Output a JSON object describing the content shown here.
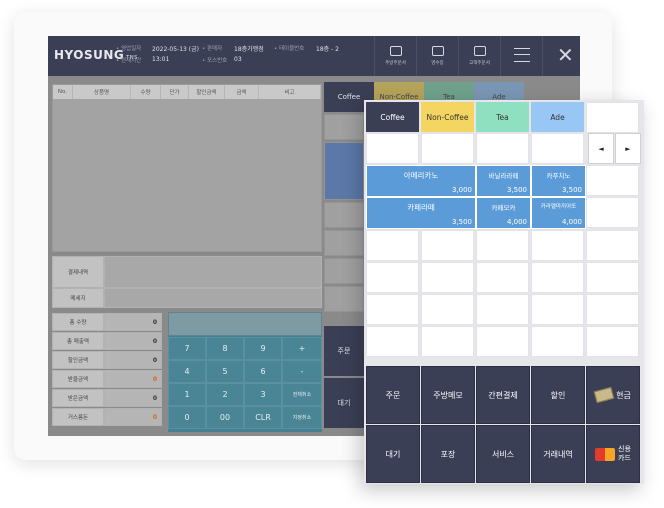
{
  "brand": {
    "name": "HYOSUNG",
    "suffix": "TNS"
  },
  "header_info": {
    "business_date_label": "• 영업일자",
    "business_date_value": "2022-05-13 (금)",
    "current_time_label": "• 현재시간",
    "current_time_value": "13:01",
    "clerk_label": "• 판매자",
    "clerk_value": "18층가맹점",
    "pos_label": "• 포스번호",
    "pos_value": "03",
    "table_label": "• 테이블번호",
    "table_value": "18층 - 2"
  },
  "header_buttons": [
    "주방주문서",
    "영수증",
    "고객주문서"
  ],
  "order_table": {
    "columns": [
      "No.",
      "상품명",
      "수량",
      "단가",
      "할인금액",
      "금액",
      "비고"
    ]
  },
  "info_labels": {
    "payment": "결제내역",
    "message": "메세지"
  },
  "summary": [
    {
      "label": "총 수량",
      "value": "0"
    },
    {
      "label": "총 매출액",
      "value": "0"
    },
    {
      "label": "할인금액",
      "value": "0"
    },
    {
      "label": "받을금액",
      "value": "0"
    },
    {
      "label": "받은금액",
      "value": "0"
    },
    {
      "label": "거스름돈",
      "value": "0"
    }
  ],
  "keypad": {
    "row1": [
      "7",
      "8",
      "9",
      "+"
    ],
    "row2": [
      "4",
      "5",
      "6",
      "-"
    ],
    "row3": [
      "1",
      "2",
      "3",
      "전체취소"
    ],
    "row4": [
      "0",
      "00",
      "CLR",
      "지정취소"
    ]
  },
  "back_actions": {
    "order": "주문",
    "hold": "대기"
  },
  "category_tabs": [
    {
      "label": "Coffee",
      "color": "#3b3f55",
      "text": "#ffffff"
    },
    {
      "label": "Non-Coffee",
      "color": "#f5d561",
      "text": "#333333"
    },
    {
      "label": "Tea",
      "color": "#8ee0c0",
      "text": "#333333"
    },
    {
      "label": "Ade",
      "color": "#98c6f5",
      "text": "#333333"
    }
  ],
  "pager": {
    "prev": "◄",
    "next": "►"
  },
  "products": [
    {
      "name": "아메리카노",
      "price": "3,000"
    },
    {
      "name": "바닐라라떼",
      "price": "3,500"
    },
    {
      "name": "카푸치노",
      "price": "3,500"
    },
    {
      "name": "카페라떼",
      "price": "3,500"
    },
    {
      "name": "카페모카",
      "price": "4,000"
    },
    {
      "name": "카라멜마끼아또",
      "price": "4,000"
    }
  ],
  "function_buttons": {
    "order": "주문",
    "kitchen_memo": "주방메모",
    "simple_pay": "간편결제",
    "discount": "할인",
    "cash": "현금",
    "hold": "대기",
    "takeout": "포장",
    "service": "서비스",
    "history": "거래내역",
    "credit_card_line1": "신용",
    "credit_card_line2": "카드"
  },
  "colors": {
    "header": "#3b3f55",
    "product": "#5b9bd8",
    "keypad": "#467f8e"
  }
}
